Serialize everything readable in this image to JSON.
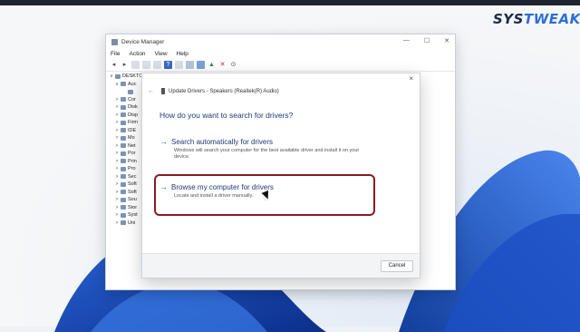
{
  "brand": {
    "prefix": "SYS",
    "suffix": "TWEAK"
  },
  "device_manager": {
    "title": "Device Manager",
    "controls": [
      "—",
      "☐",
      "✕"
    ],
    "menu": [
      "File",
      "Action",
      "View",
      "Help"
    ],
    "tree": [
      {
        "chev": "∨",
        "label": "DESKTC"
      },
      {
        "chev": "∨",
        "label": "Auc"
      },
      {
        "chev": "",
        "label": ""
      },
      {
        "chev": ">",
        "label": "Cor"
      },
      {
        "chev": ">",
        "label": "Disk"
      },
      {
        "chev": ">",
        "label": "Disp"
      },
      {
        "chev": ">",
        "label": "Firm"
      },
      {
        "chev": ">",
        "label": "IDE"
      },
      {
        "chev": ">",
        "label": "Mo"
      },
      {
        "chev": ">",
        "label": "Net"
      },
      {
        "chev": ">",
        "label": "Por"
      },
      {
        "chev": ">",
        "label": "Prin"
      },
      {
        "chev": ">",
        "label": "Pro"
      },
      {
        "chev": ">",
        "label": "Sec"
      },
      {
        "chev": ">",
        "label": "Soft"
      },
      {
        "chev": ">",
        "label": "Soft"
      },
      {
        "chev": ">",
        "label": "Sou"
      },
      {
        "chev": ">",
        "label": "Stor"
      },
      {
        "chev": ">",
        "label": "Syst"
      },
      {
        "chev": ">",
        "label": "Uni"
      }
    ]
  },
  "dialog": {
    "close": "×",
    "back": "←",
    "header": "Update Drivers - Speakers (Realtek(R) Audio)",
    "question": "How do you want to search for drivers?",
    "option1": {
      "title": "Search automatically for drivers",
      "desc": "Windows will search your computer for the best available driver and install it on your device."
    },
    "option2": {
      "title": "Browse my computer for drivers",
      "desc": "Locate and install a driver manually."
    },
    "arrow": "→",
    "cancel": "Cancel"
  },
  "colors": {
    "highlight": "#8a1b1f",
    "link": "#1d3a73"
  }
}
